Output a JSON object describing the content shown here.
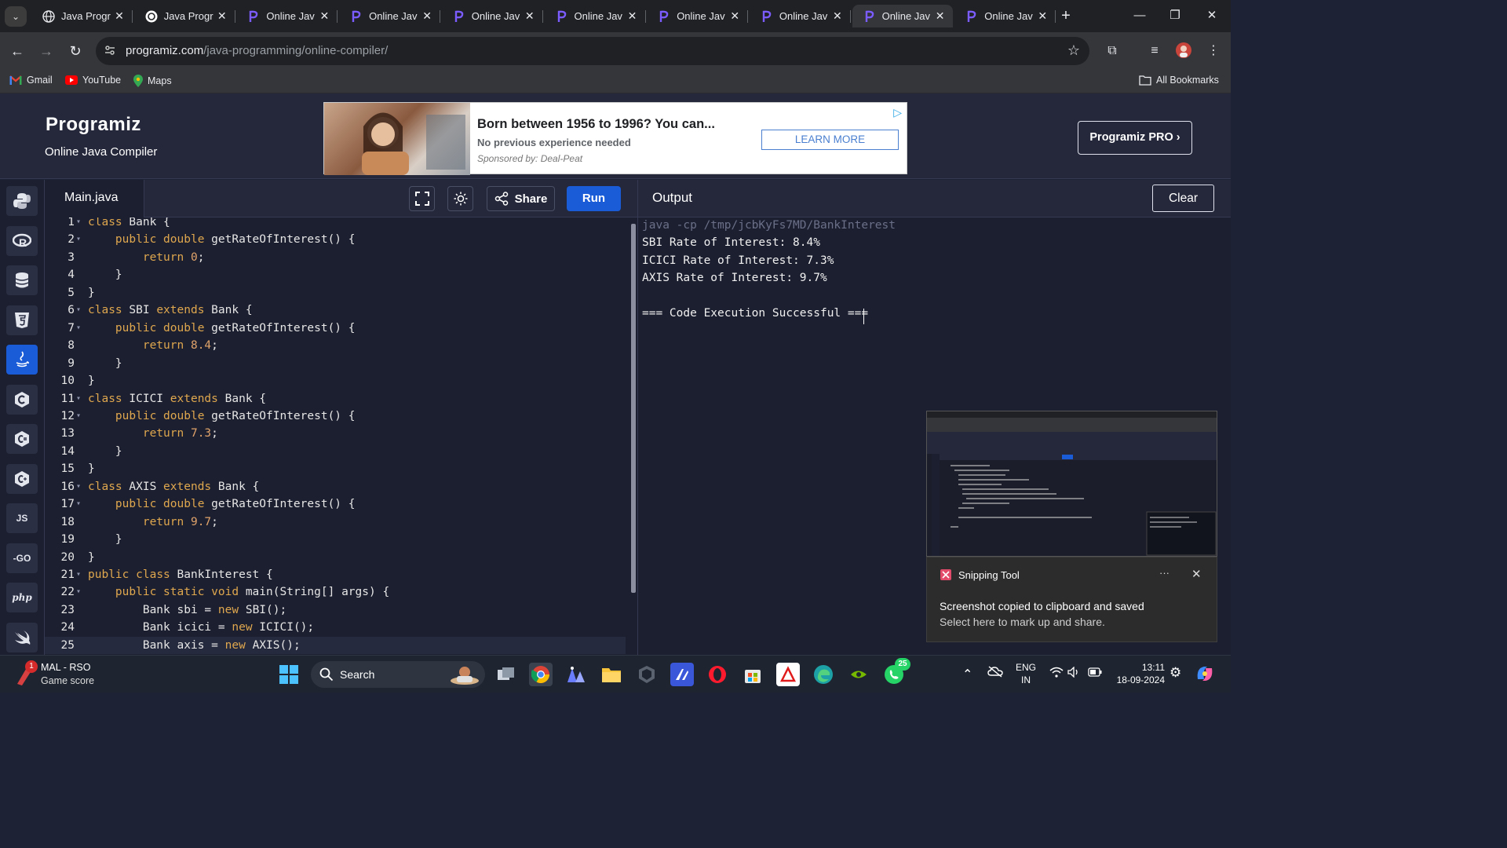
{
  "browser": {
    "tabs": [
      {
        "title": "Java Progr",
        "icon": "globe-icon"
      },
      {
        "title": "Java Progr",
        "icon": "openai-icon"
      },
      {
        "title": "Online Jav",
        "icon": "programiz-icon"
      },
      {
        "title": "Online Jav",
        "icon": "programiz-icon"
      },
      {
        "title": "Online Jav",
        "icon": "programiz-icon"
      },
      {
        "title": "Online Jav",
        "icon": "programiz-icon"
      },
      {
        "title": "Online Jav",
        "icon": "programiz-icon"
      },
      {
        "title": "Online Jav",
        "icon": "programiz-icon"
      },
      {
        "title": "Online Jav",
        "icon": "programiz-icon",
        "active": true
      },
      {
        "title": "Online Jav",
        "icon": "programiz-icon"
      }
    ],
    "url_host": "programiz.com",
    "url_path": "/java-programming/online-compiler/",
    "bookmarks": [
      "Gmail",
      "YouTube",
      "Maps"
    ],
    "all_bookmarks": "All Bookmarks"
  },
  "site": {
    "logo": "Programiz",
    "subtitle": "Online Java Compiler",
    "pro_button": "Programiz PRO ›",
    "ad": {
      "headline": "Born between 1956 to 1996? You can...",
      "subline": "No previous experience needed",
      "sponsor": "Sponsored by: Deal-Peat",
      "cta": "LEARN MORE"
    }
  },
  "languages": [
    {
      "name": "python-icon",
      "label": ""
    },
    {
      "name": "r-icon",
      "label": ""
    },
    {
      "name": "sql-icon",
      "label": ""
    },
    {
      "name": "html5-icon",
      "label": ""
    },
    {
      "name": "java-icon",
      "label": "",
      "active": true
    },
    {
      "name": "c-icon",
      "label": ""
    },
    {
      "name": "csharp-icon",
      "label": ""
    },
    {
      "name": "cpp-icon",
      "label": ""
    },
    {
      "name": "js-icon",
      "label": "JS"
    },
    {
      "name": "go-icon",
      "label": "-GO"
    },
    {
      "name": "php-icon",
      "label": "php"
    },
    {
      "name": "swift-icon",
      "label": ""
    }
  ],
  "editor": {
    "filename": "Main.java",
    "share_label": "Share",
    "run_label": "Run",
    "lines": [
      "class Bank {",
      "    public double getRateOfInterest() {",
      "        return 0;",
      "    }",
      "}",
      "class SBI extends Bank {",
      "    public double getRateOfInterest() {",
      "        return 8.4;",
      "    }",
      "}",
      "class ICICI extends Bank {",
      "    public double getRateOfInterest() {",
      "        return 7.3;",
      "    }",
      "}",
      "class AXIS extends Bank {",
      "    public double getRateOfInterest() {",
      "        return 9.7;",
      "    }",
      "}",
      "public class BankInterest {",
      "    public static void main(String[] args) {",
      "        Bank sbi = new SBI();",
      "        Bank icici = new ICICI();",
      "        Bank axis = new AXIS();"
    ]
  },
  "output": {
    "title": "Output",
    "clear_label": "Clear",
    "command": "java -cp /tmp/jcbKyFs7MD/BankInterest",
    "lines": [
      "SBI Rate of Interest: 8.4%",
      "ICICI Rate of Interest: 7.3%",
      "AXIS Rate of Interest: 9.7%",
      "",
      "=== Code Execution Successful ==="
    ]
  },
  "toast": {
    "app": "Snipping Tool",
    "message": "Screenshot copied to clipboard and saved",
    "sub": "Select here to mark up and share.",
    "more": "···"
  },
  "taskbar": {
    "game_title": "MAL - RSO",
    "game_sub": "Game score",
    "game_badge": "1",
    "search_label": "Search",
    "whatsapp_badge": "25",
    "lang_top": "ENG",
    "lang_bottom": "IN",
    "time": "13:11",
    "date": "18-09-2024"
  },
  "colors": {
    "accent": "#1a5bd7",
    "editor_bg": "#1c1f30",
    "keyword": "#dfa74e"
  }
}
